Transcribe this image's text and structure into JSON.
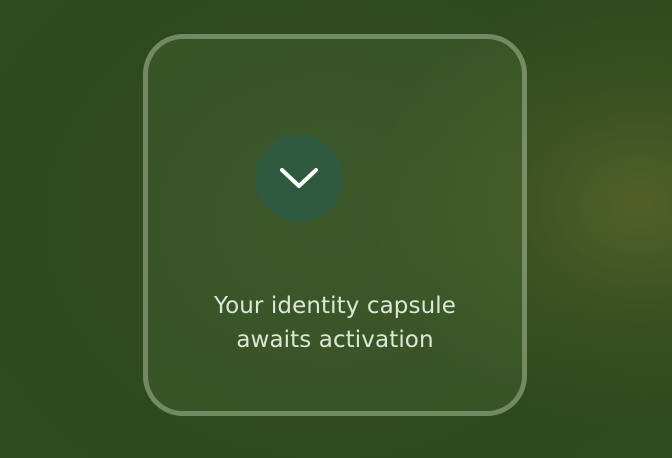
{
  "card": {
    "icon": "chevron-down-icon",
    "message_line1": "Your identity capsule",
    "message_line2": "awaits activation"
  },
  "colors": {
    "background": "#2c4a1c",
    "button": "#2f5a3f",
    "text": "#dde7d8"
  }
}
